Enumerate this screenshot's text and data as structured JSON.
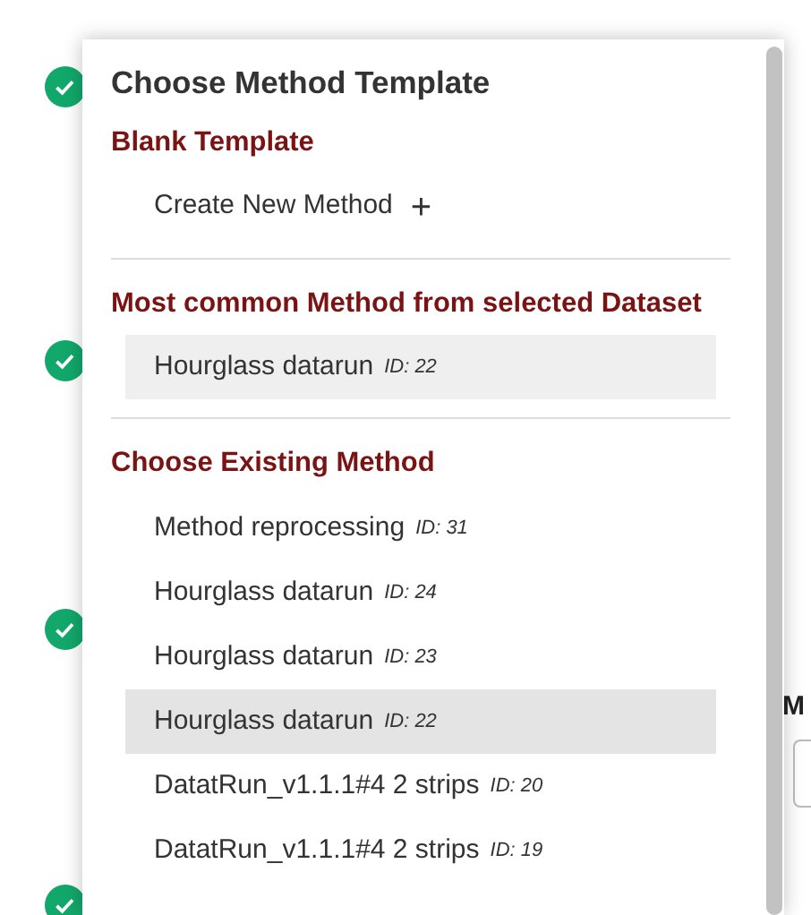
{
  "background": {
    "steps": [
      {
        "done": true
      },
      {
        "done": true
      },
      {
        "done": true
      },
      {
        "done": true
      }
    ],
    "field_label": "M"
  },
  "popup": {
    "title": "Choose Method Template",
    "sections": [
      {
        "kind": "blank",
        "heading": "Blank Template",
        "items": [
          {
            "label": "Create New Method",
            "icon": "+"
          }
        ]
      },
      {
        "kind": "suggested",
        "heading": "Most common Method from selected Dataset",
        "items": [
          {
            "label": "Hourglass datarun",
            "id": "ID: 22"
          }
        ]
      },
      {
        "kind": "existing",
        "heading": "Choose Existing Method",
        "items": [
          {
            "label": "Method reprocessing",
            "id": "ID: 31",
            "selected": false
          },
          {
            "label": "Hourglass datarun",
            "id": "ID: 24",
            "selected": false
          },
          {
            "label": "Hourglass datarun",
            "id": "ID: 23",
            "selected": false
          },
          {
            "label": "Hourglass datarun",
            "id": "ID: 22",
            "selected": true
          },
          {
            "label": "DatatRun_v1.1.1#4 2 strips",
            "id": "ID: 20",
            "selected": false
          },
          {
            "label": "DatatRun_v1.1.1#4 2 strips",
            "id": "ID: 19",
            "selected": false
          }
        ]
      }
    ]
  }
}
